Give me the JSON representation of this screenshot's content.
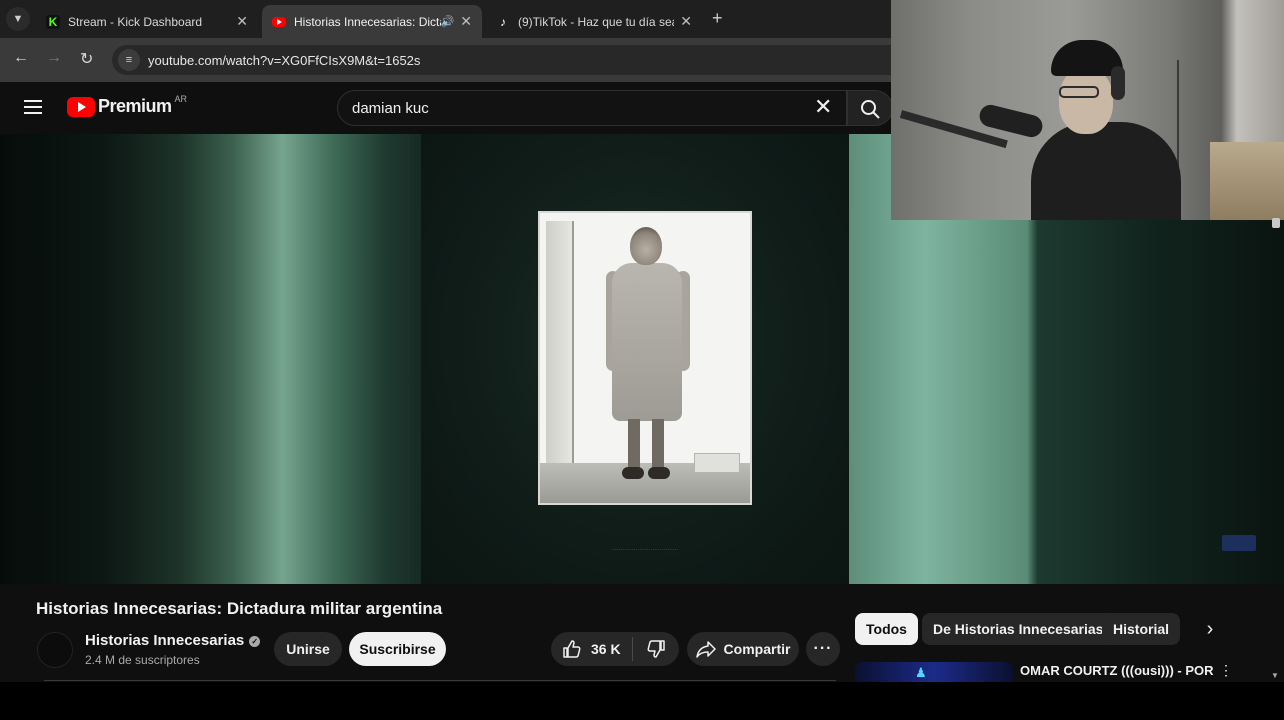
{
  "browser": {
    "tabs": [
      {
        "title": "Stream - Kick Dashboard",
        "favicon": "kick-icon",
        "active": false
      },
      {
        "title": "Historias Innecesarias: Dicta",
        "favicon": "youtube-icon",
        "active": true,
        "audio": true
      },
      {
        "title": "(9)TikTok - Haz que tu día sea e",
        "favicon": "tiktok-icon",
        "active": false
      }
    ],
    "url": "youtube.com/watch?v=XG0FfCIsX9M&t=1652s"
  },
  "youtube": {
    "logo_text": "Premium",
    "logo_country": "AR",
    "search_value": "damian kuc",
    "video": {
      "title": "Historias Innecesarias: Dictadura militar argentina",
      "channel": "Historias Innecesarias",
      "subscribers": "2.4 M de suscriptores",
      "likes": "36 K"
    },
    "buttons": {
      "join": "Unirse",
      "subscribe": "Suscribirse",
      "share": "Compartir"
    },
    "chips": [
      "Todos",
      "De Historias Innecesarias",
      "Historial"
    ],
    "recommendation": {
      "title": "OMAR COURTZ (((ousi))) - POR"
    }
  },
  "colors": {
    "youtube_red": "#ff0000",
    "kick_green": "#53fc18",
    "background": "#0f0f0f"
  }
}
